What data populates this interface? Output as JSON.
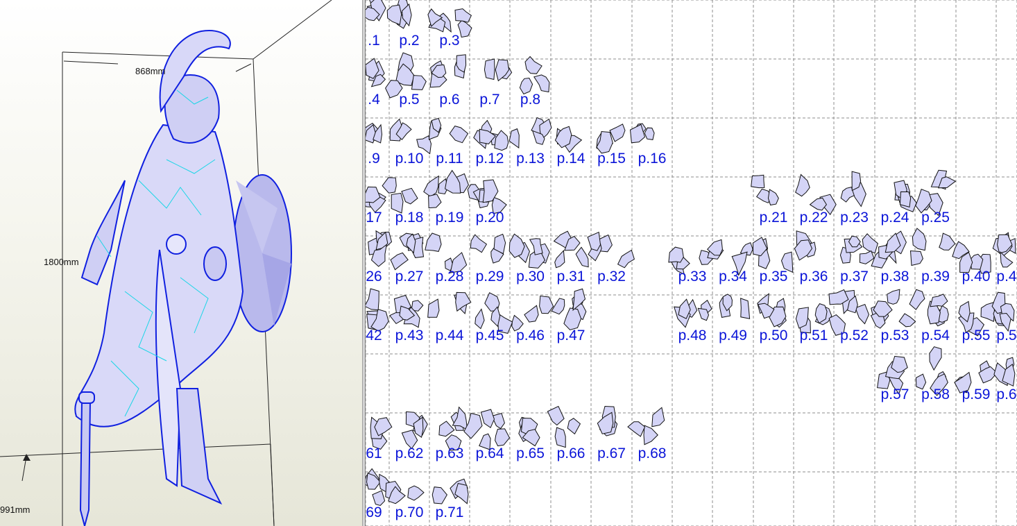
{
  "viewer_3d": {
    "dimensions": {
      "width": "868mm",
      "height": "1800mm",
      "depth": "991mm"
    },
    "model_description": "3D warrior figure"
  },
  "unfold_view": {
    "page_labels": [
      ".1",
      "p.2",
      "p.3",
      ".4",
      "p.5",
      "p.6",
      "p.7",
      "p.8",
      ".9",
      "p.10",
      "p.11",
      "p.12",
      "p.13",
      "p.14",
      "p.15",
      "p.16",
      "17",
      "p.18",
      "p.19",
      "p.20",
      "p.21",
      "p.22",
      "p.23",
      "p.24",
      "p.25",
      "26",
      "p.27",
      "p.28",
      "p.29",
      "p.30",
      "p.31",
      "p.32",
      "p.33",
      "p.34",
      "p.35",
      "p.36",
      "p.37",
      "p.38",
      "p.39",
      "p.40",
      "p.4",
      "42",
      "p.43",
      "p.44",
      "p.45",
      "p.46",
      "p.47",
      "p.48",
      "p.49",
      "p.50",
      "p.51",
      "p.52",
      "p.53",
      "p.54",
      "p.55",
      "p.5",
      "p.57",
      "p.58",
      "p.59",
      "p.6",
      "61",
      "p.62",
      "p.63",
      "p.64",
      "p.65",
      "p.66",
      "p.67",
      "p.68",
      "69",
      "p.70",
      "p.71"
    ],
    "colors": {
      "label": "#0a14d8",
      "part_fill": "#d4d4f6",
      "grid": "#8c8c8c"
    }
  }
}
